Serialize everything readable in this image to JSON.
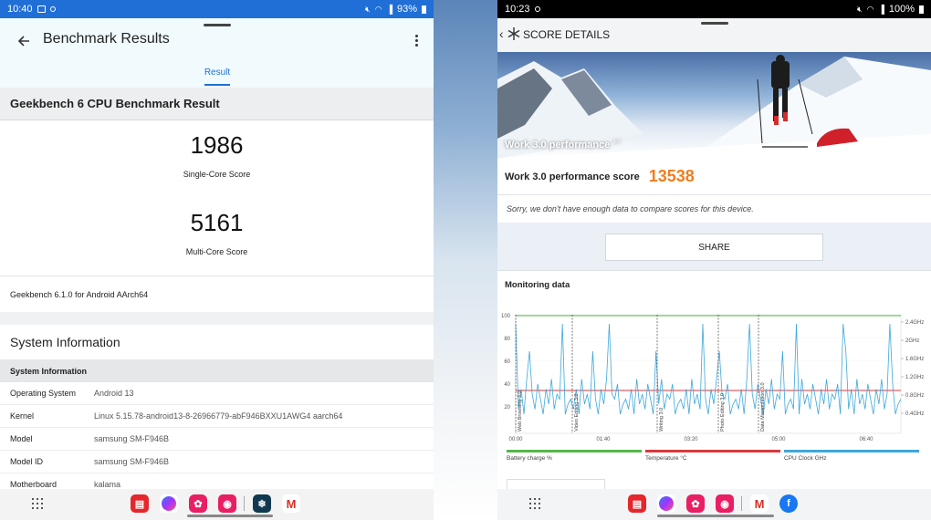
{
  "left": {
    "status": {
      "time": "10:40",
      "battery": "93%"
    },
    "appbar": {
      "title": "Benchmark Results"
    },
    "tab": {
      "label": "Result"
    },
    "result_header": "Geekbench 6 CPU Benchmark Result",
    "single_core": {
      "score": "1986",
      "label": "Single-Core Score"
    },
    "multi_core": {
      "score": "5161",
      "label": "Multi-Core Score"
    },
    "version": "Geekbench 6.1.0 for Android AArch64",
    "system_info": {
      "title": "System Information",
      "subheader": "System Information",
      "rows": [
        {
          "key": "Operating System",
          "value": "Android 13"
        },
        {
          "key": "Kernel",
          "value": "Linux 5.15.78-android13-8-26966779-abF946BXXU1AWG4 aarch64"
        },
        {
          "key": "Model",
          "value": "samsung SM-F946B"
        },
        {
          "key": "Model ID",
          "value": "samsung SM-F946B"
        },
        {
          "key": "Motherboard",
          "value": "kalama"
        }
      ]
    },
    "dock": [
      "apps-grid-icon",
      "flipboard-icon",
      "messenger-icon",
      "flower-app-icon",
      "screen-recorder-icon",
      "geekbench-icon",
      "gmail-icon"
    ]
  },
  "right": {
    "status": {
      "time": "10:23",
      "battery": "100%"
    },
    "appbar": {
      "title": "SCORE DETAILS"
    },
    "hero": {
      "caption": "Work 3.0 performance",
      "caption_sup": "3.0"
    },
    "score": {
      "label": "Work 3.0 performance score",
      "value": "13538",
      "color": "#f07d1f"
    },
    "notice": "Sorry, we don't have enough data to compare scores for this device.",
    "share_label": "SHARE",
    "monitoring": {
      "title": "Monitoring data",
      "chart_data": {
        "type": "line",
        "y_left_ticks": [
          "100",
          "80",
          "60",
          "40",
          "20"
        ],
        "y_right_ticks": [
          "2.4GHz",
          "2GHz",
          "1.6GHz",
          "1.2GHz",
          "0.8GHz",
          "0.4GHz"
        ],
        "x_ticks": [
          "00:00",
          "01:40",
          "03:20",
          "05:00",
          "06:40"
        ],
        "markers": [
          "Web Browsing 3.0",
          "Video Editing 3.0",
          "Writing 3.0",
          "Photo Editing 3.0",
          "Data Manipulation 3.0"
        ],
        "legend": [
          {
            "label": "Battery charge %",
            "color": "#55b849"
          },
          {
            "label": "Temperature °C",
            "color": "#d9393d"
          },
          {
            "label": "CPU Clock GHz",
            "color": "#3ea8dc"
          }
        ]
      }
    },
    "dock": [
      "apps-grid-icon",
      "flipboard-icon",
      "messenger-icon",
      "flower-app-icon",
      "screen-recorder-icon",
      "gmail-icon",
      "facebook-icon"
    ]
  }
}
